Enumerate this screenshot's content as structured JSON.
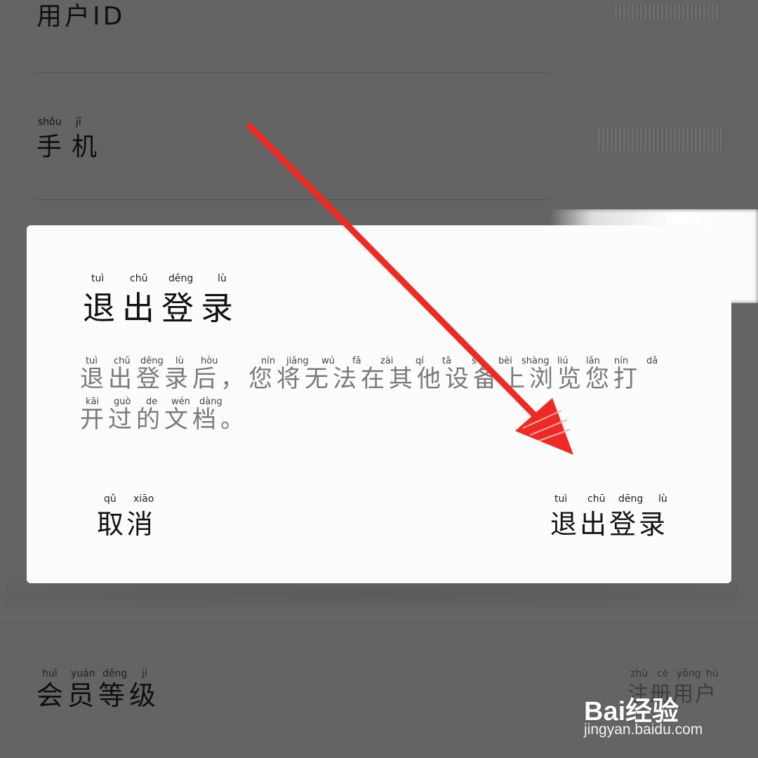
{
  "settings": {
    "rows": [
      {
        "label": "用户ID",
        "pinyin": []
      },
      {
        "label": "手机",
        "pinyin": [
          "shǒu",
          "jī"
        ]
      },
      {
        "label": "会员等级",
        "pinyin": [
          "huì",
          "yuán",
          "děng",
          "jí"
        ],
        "value": "注册用户",
        "value_pinyin": [
          "zhù",
          "cè",
          "yǒng",
          "hù"
        ]
      }
    ]
  },
  "dialog": {
    "title": "退出登录",
    "title_pinyin": [
      "tuì",
      "chū",
      "dēng",
      "lù"
    ],
    "message_line1": "退出登录后，您将无法在其他设备上浏览您打",
    "message_line1_pinyin": [
      "tuì",
      "chū",
      "dēng",
      "lù",
      "hòu",
      "nín",
      "jiāng",
      "wú",
      "fǎ",
      "zài",
      "qí",
      "tā",
      "s",
      "bèi",
      "shàng",
      "liú",
      "lǎn",
      "nín",
      "dǎ"
    ],
    "message_line2": "开过的文档。",
    "message_line2_pinyin": [
      "kāi",
      "guò",
      "de",
      "wén",
      "dàng"
    ],
    "cancel_label": "取消",
    "cancel_pinyin": [
      "qǔ",
      "xiāo"
    ],
    "confirm_label": "退出登录",
    "confirm_pinyin": [
      "tuì",
      "chū",
      "dēng",
      "lù"
    ]
  },
  "colors": {
    "overlay": "#636463",
    "dialog_bg": "#fdfcfd",
    "message_text": "#7a7a7a",
    "arrow": "#ef2a24"
  },
  "watermark": {
    "logo": "Bai经验",
    "url": "jingyan.baidu.com"
  }
}
